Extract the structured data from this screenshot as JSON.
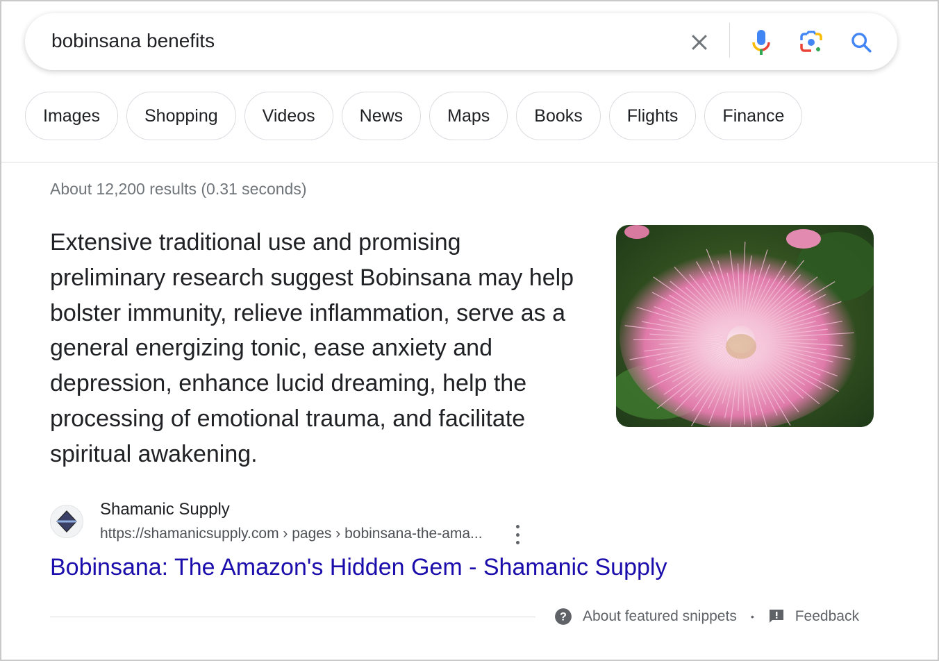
{
  "search": {
    "query": "bobinsana benefits",
    "icons": [
      "clear-icon",
      "microphone-icon",
      "lens-camera-icon",
      "search-icon"
    ]
  },
  "chips": [
    {
      "label": "Images"
    },
    {
      "label": "Shopping"
    },
    {
      "label": "Videos"
    },
    {
      "label": "News"
    },
    {
      "label": "Maps"
    },
    {
      "label": "Books"
    },
    {
      "label": "Flights"
    },
    {
      "label": "Finance"
    }
  ],
  "stats": "About 12,200 results (0.31 seconds)",
  "featured_snippet": {
    "text": "Extensive traditional use and promising preliminary research suggest Bobinsana may help bolster immunity, relieve inflammation, serve as a general energizing tonic, ease anxiety and depression, enhance lucid dreaming, help the processing of emotional trauma, and facilitate spiritual awakening.",
    "image_alt": "pink bobinsana flower",
    "source": {
      "site_name": "Shamanic Supply",
      "url": "https://shamanicsupply.com › pages › bobinsana-the-ama...",
      "title": "Bobinsana: The Amazon's Hidden Gem - Shamanic Supply"
    }
  },
  "footer": {
    "about_label": "About featured snippets",
    "separator": "•",
    "feedback_label": "Feedback"
  },
  "colors": {
    "link": "#1a0dab",
    "google_blue": "#4285f4",
    "google_red": "#ea4335",
    "google_yellow": "#fbbc04",
    "google_green": "#34a853"
  }
}
